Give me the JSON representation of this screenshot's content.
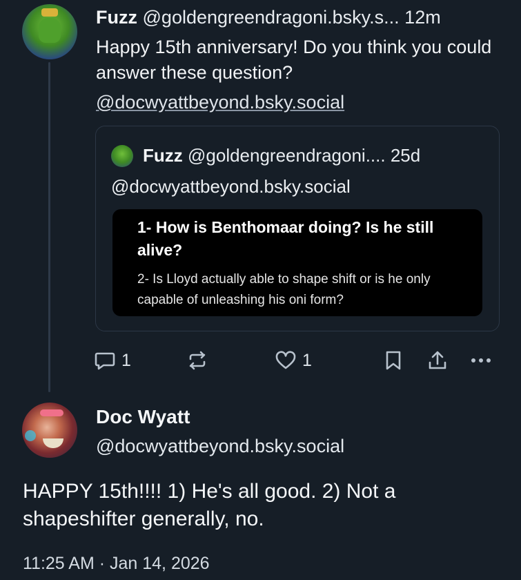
{
  "parent_post": {
    "author_name": "Fuzz",
    "author_handle": "@goldengreendragoni.bsky.s...",
    "time_ago": "12m",
    "text": "Happy 15th anniversary! Do you think you could answer these question?",
    "mention": "@docwyattbeyond.bsky.social",
    "avatar_icon": "avatar-fuzz"
  },
  "quoted_post": {
    "author_name": "Fuzz",
    "author_handle": "@goldengreendragoni....",
    "time_ago": "25d",
    "text": "@docwyattbeyond.bsky.social",
    "image_text": {
      "question_1": "1- How is Benthomaar doing? Is he still alive?",
      "question_2": "2- Is Lloyd actually able to shape shift or is he only capable of unleashing his oni form?"
    }
  },
  "actions": {
    "reply_count": "1",
    "repost_count": "",
    "like_count": "1",
    "icons": [
      "reply-icon",
      "repost-icon",
      "like-icon",
      "bookmark-icon",
      "share-icon",
      "more-icon"
    ]
  },
  "reply_post": {
    "author_name": "Doc Wyatt",
    "author_handle": "@docwyattbeyond.bsky.social",
    "text": "HAPPY 15th!!!! 1) He's all good. 2) Not a shapeshifter generally, no.",
    "timestamp": "11:25 AM · Jan 14, 2026",
    "avatar_icon": "avatar-doc-wyatt"
  },
  "colors": {
    "background": "#161e27",
    "text": "#f1f3f5",
    "muted": "#b8c2cd",
    "border": "#2c3746"
  }
}
